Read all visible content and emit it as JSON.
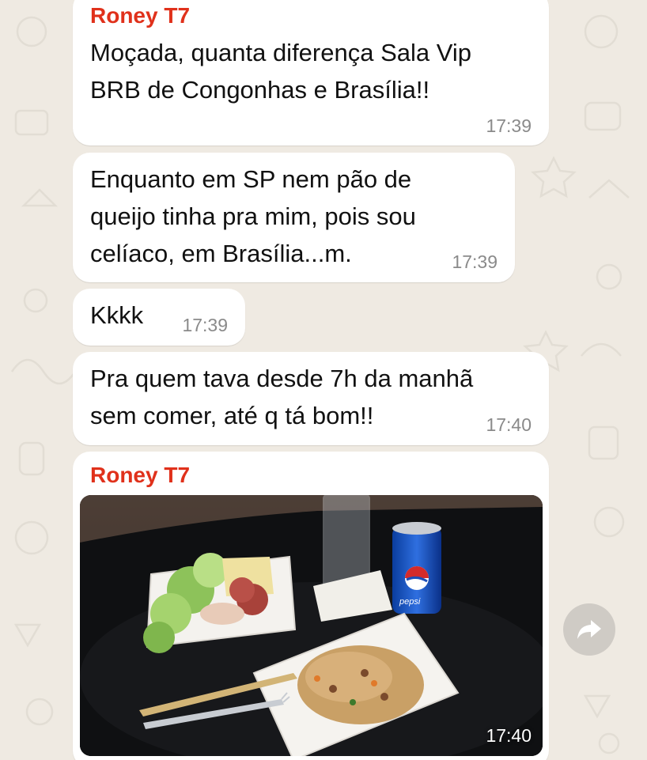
{
  "messages": [
    {
      "sender": "Roney T7",
      "text": "Moçada, quanta diferença Sala Vip\nBRB de Congonhas e Brasília!!",
      "time": "17:39"
    },
    {
      "text": "Enquanto em SP nem pão de\nqueijo tinha pra mim, pois sou\ncelíaco, em Brasília...m.",
      "time": "17:39"
    },
    {
      "text": "Kkkk",
      "time": "17:39"
    },
    {
      "text": "Pra quem tava desde 7h da manhã\nsem comer, até q tá bom!!",
      "time": "17:40"
    },
    {
      "sender": "Roney T7",
      "photo_text": "pepsi",
      "time": "17:40"
    }
  ],
  "colors": {
    "sender": "#e0311b",
    "background": "#efeae2",
    "bubble": "#ffffff"
  },
  "icons": {
    "forward": "forward-arrow-icon"
  }
}
